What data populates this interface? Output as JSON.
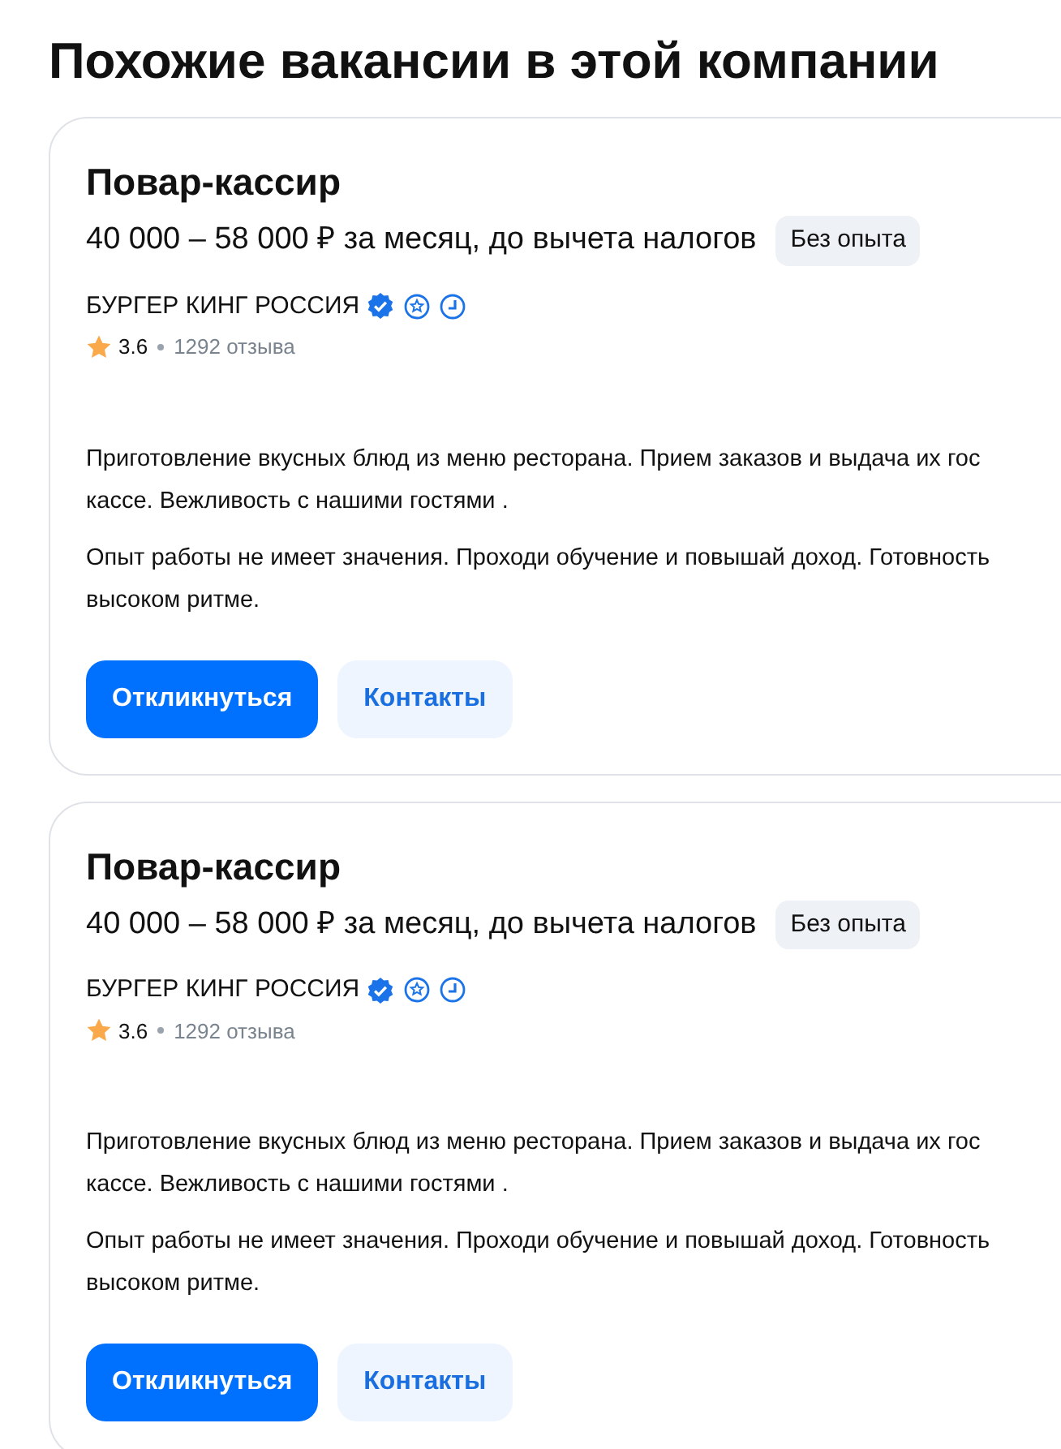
{
  "heading": "Похожие вакансии в этой компании",
  "vacancies": [
    {
      "title": "Повар-кассир",
      "salary": "40 000 – 58 000 ₽ за месяц, до вычета налогов",
      "experience_tag": "Без опыта",
      "company": "БУРГЕР КИНГ РОССИЯ",
      "verified": true,
      "rating": "3.6",
      "reviews": "1292 отзыва",
      "description": [
        [
          "Приготовление вкусных блюд из меню ресторана. Прием заказов и выдача их гос",
          "кассе. Вежливость с нашими гостями ."
        ],
        [
          "Опыт работы не имеет значения. Проходи обучение и повышай доход. Готовность",
          "высоком ритме."
        ]
      ],
      "buttons": [
        {
          "label": "Откликнуться",
          "kind": "primary"
        },
        {
          "label": "Контакты",
          "kind": "secondary"
        }
      ]
    },
    {
      "title": "Повар-кассир",
      "salary": "40 000 – 58 000 ₽ за месяц, до вычета налогов",
      "experience_tag": "Без опыта",
      "company": "БУРГЕР КИНГ РОССИЯ",
      "verified": true,
      "rating": "3.6",
      "reviews": "1292 отзыва",
      "description": [
        [
          "Приготовление вкусных блюд из меню ресторана. Прием заказов и выдача их гос",
          "кассе. Вежливость с нашими гостями ."
        ],
        [
          "Опыт работы не имеет значения. Проходи обучение и повышай доход. Готовность",
          "высоком ритме."
        ]
      ],
      "buttons": [
        {
          "label": "Откликнуться",
          "kind": "primary"
        },
        {
          "label": "Контакты",
          "kind": "secondary"
        }
      ]
    }
  ]
}
